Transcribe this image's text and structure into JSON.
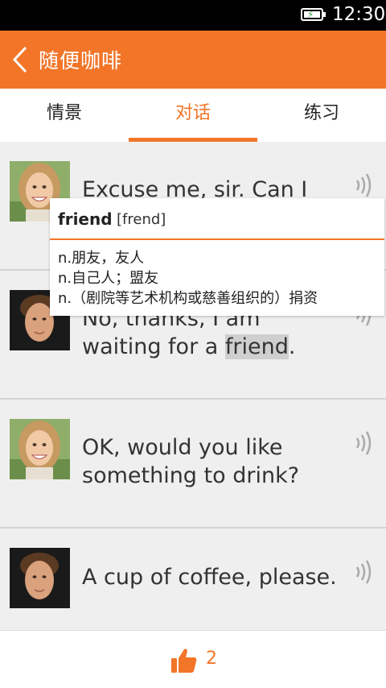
{
  "status_bar": {
    "time": "12:30",
    "battery_icon": "battery-charging-icon"
  },
  "header": {
    "title": "随便咖啡",
    "back_icon": "back-chevron-icon",
    "color": "#f27528"
  },
  "tabs": [
    {
      "label": "情景",
      "active": false
    },
    {
      "label": "对话",
      "active": true
    },
    {
      "label": "练习",
      "active": false
    }
  ],
  "dialogues": [
    {
      "speaker": "woman",
      "text": "Excuse me, sir. Can I"
    },
    {
      "speaker": "man",
      "text_line1": "No, thanks, I am",
      "text_pre": "waiting for a ",
      "text_word": "friend",
      "text_post": "."
    },
    {
      "speaker": "woman",
      "text_line1": "OK, would you like",
      "text_line2": "something to drink?"
    },
    {
      "speaker": "man",
      "text": "A cup of coffee, please."
    }
  ],
  "popup": {
    "word": "friend",
    "phonetic": "[frend]",
    "definitions": [
      "n.朋友，友人",
      "n.自己人；盟友",
      "n.（剧院等艺术机构或慈善组织的）捐资"
    ]
  },
  "footer": {
    "like_icon": "thumbs-up-icon",
    "like_count": "2"
  }
}
